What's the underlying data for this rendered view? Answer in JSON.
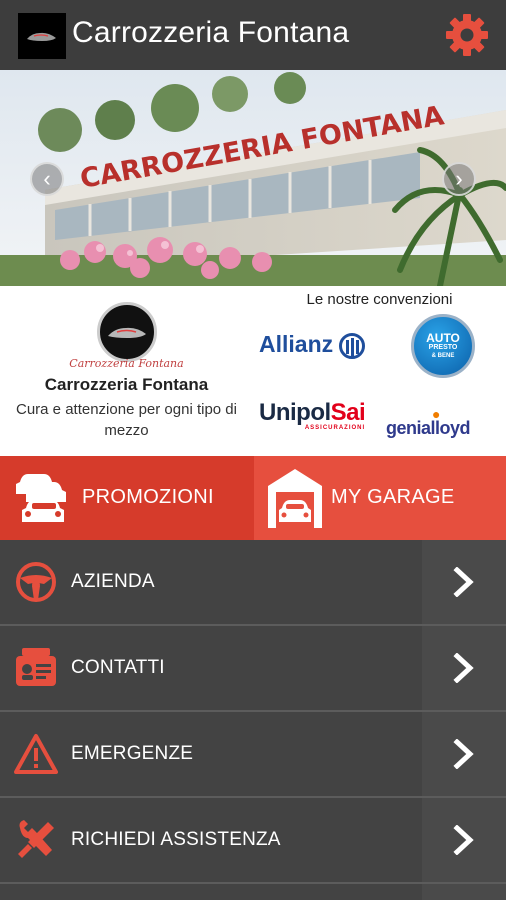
{
  "header": {
    "title": "Carrozzeria Fontana"
  },
  "hero": {
    "building_sign": "CARROZZERIA FONTANA"
  },
  "company": {
    "script_name": "Carrozzeria Fontana",
    "name": "Carrozzeria Fontana",
    "tagline": "Cura e attenzione per ogni tipo di mezzo"
  },
  "partners": {
    "title": "Le nostre convenzioni",
    "allianz": "Allianz",
    "unipol_main": "Unipol",
    "unipol_sai": "Sai",
    "unipol_sub": "ASSICURAZIONI",
    "auto_line1": "AUTO",
    "auto_line2": "PRESTO",
    "auto_line3": "& BENE",
    "genia_g": "genia",
    "genia_rest": "lloyd"
  },
  "tiles": {
    "promo": "PROMOZIONI",
    "garage": "MY GARAGE"
  },
  "menu": {
    "items": [
      {
        "label": "AZIENDA",
        "icon": "steering-wheel-icon"
      },
      {
        "label": "CONTATTI",
        "icon": "contact-card-icon"
      },
      {
        "label": "EMERGENZE",
        "icon": "warning-icon"
      },
      {
        "label": "RICHIEDI ASSISTENZA",
        "icon": "tools-icon"
      }
    ]
  },
  "colors": {
    "accent": "#e64f3e",
    "accent_dark": "#d63b2b",
    "menu_bg": "#434343",
    "header_bg": "#3d3d3d"
  }
}
